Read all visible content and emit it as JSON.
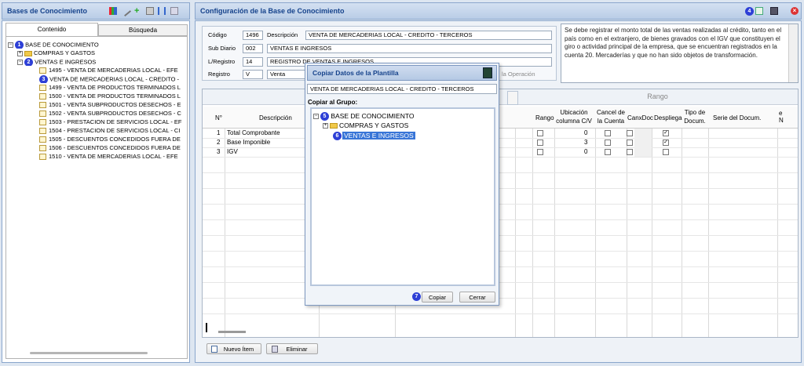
{
  "left": {
    "title": "Bases de Conocimiento",
    "tabs": [
      "Contenido",
      "Búsqueda"
    ],
    "tree": [
      {
        "label": "BASE DE CONOCIMIENTO",
        "badge": "1"
      },
      {
        "label": "COMPRAS Y GASTOS"
      },
      {
        "label": "VENTAS E INGRESOS",
        "badge": "2"
      },
      {
        "label": "1495 - VENTA DE MERCADERIAS LOCAL - EFE"
      },
      {
        "label": "VENTA DE MERCADERIAS LOCAL - CREDITO -",
        "badge": "3"
      },
      {
        "label": "1499 - VENTA DE PRODUCTOS TERMINADOS L"
      },
      {
        "label": "1500 - VENTA DE PRODUCTOS TERMINADOS L"
      },
      {
        "label": "1501 - VENTA SUBPRODUCTOS DESECHOS - E"
      },
      {
        "label": "1502 - VENTA SUBPRODUCTOS DESECHOS - C"
      },
      {
        "label": "1503 - PRESTACION DE SERVICIOS LOCAL - EF"
      },
      {
        "label": "1504 - PRESTACION DE SERVICIOS LOCAL - CI"
      },
      {
        "label": "1505 - DESCUENTOS CONCEDIDOS FUERA DE"
      },
      {
        "label": "1506 - DESCUENTOS CONCEDIDOS FUERA DE"
      },
      {
        "label": "1510 - VENTA DE MERCADERIAS LOCAL - EFE"
      }
    ]
  },
  "right": {
    "title": "Configuración de la Base de Conocimiento",
    "badge4": "4",
    "form": {
      "codigo_label": "Código",
      "codigo": "1496",
      "descripcion_label": "Descripción",
      "descripcion": "VENTA DE MERCADERIAS LOCAL - CREDITO - TERCEROS",
      "subdiario_label": "Sub Diario",
      "subdiario_code": "002",
      "subdiario": "VENTAS E INGRESOS",
      "lregistro_label": "L/Registro",
      "lregistro_code": "14",
      "lregistro": "REGISTRO DE VENTAS E INGRESOS",
      "registro_label": "Registro",
      "registro_code": "V",
      "registro": "Venta",
      "operacion_hint": "la Operación"
    },
    "note": "Se debe registrar el monto total de las ventas realizadas al crédito, tanto en el país como en el extranjero, de bienes gravados con el IGV que constituyen el giro o actividad principal de la empresa, que se encuentran registrados en la cuenta 20. Mercaderías y que no han sido objetos de transformación.",
    "rango_header": "Rango",
    "columns": [
      "N°",
      "Descripción",
      "Rango",
      "Ubicación columna C/V",
      "Cancel de la Cuenta",
      "CanxDoc",
      "Despliega",
      "Tipo de Docum.",
      "Serie del Docum.",
      "e N"
    ],
    "rows": [
      {
        "n": "1",
        "desc": "Total Comprobante",
        "ubic": "0",
        "desp": true
      },
      {
        "n": "2",
        "desc": "Base Imponible",
        "ubic": "3",
        "desp": true
      },
      {
        "n": "3",
        "desc": "IGV",
        "ubic": "0",
        "desp": false
      }
    ],
    "nuevo": "Nuevo Ítem",
    "eliminar": "Eliminar"
  },
  "dialog": {
    "title": "Copiar Datos de la Plantilla",
    "plantilla": "VENTA DE MERCADERIAS LOCAL - CREDITO - TERCEROS",
    "grupo_label": "Copiar al Grupo:",
    "tree": [
      {
        "label": "BASE DE CONOCIMIENTO",
        "badge": "5"
      },
      {
        "label": "COMPRAS Y GASTOS"
      },
      {
        "label": "VENTAS E INGRESOS",
        "badge": "6"
      }
    ],
    "copiar": "Copiar",
    "cerrar": "Cerrar",
    "badge7": "7"
  }
}
